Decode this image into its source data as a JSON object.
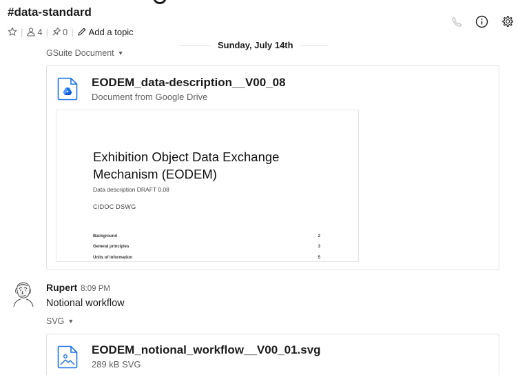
{
  "channel": {
    "name": "#data-standard",
    "members_count": "4",
    "pins_count": "0",
    "add_topic_label": "Add a topic"
  },
  "header_icons": [
    "phone-icon",
    "info-icon",
    "gear-icon"
  ],
  "date_divider": "Sunday, July 14th",
  "attachment1": {
    "type_label": "GSuite Document",
    "title": "EODEM_data-description__V00_08",
    "subtitle": "Document from Google Drive",
    "preview": {
      "title": "Exhibition Object Data Exchange Mechanism (EODEM)",
      "subtitle": "Data description DRAFT 0.08",
      "org": "CIDOC DSWG",
      "toc": [
        {
          "label": "Background",
          "page": "2"
        },
        {
          "label": "General principles",
          "page": "3"
        },
        {
          "label": "Units of information",
          "page": "5"
        }
      ]
    }
  },
  "message": {
    "author": "Rupert",
    "time": "8:09 PM",
    "text": "Notional workflow"
  },
  "attachment2": {
    "type_label": "SVG",
    "title": "EODEM_notional_workflow__V00_01.svg",
    "subtitle": "289 kB SVG"
  },
  "colors": {
    "text": "#1d1c1d",
    "muted": "#616061",
    "border": "#e1e1e1",
    "drive_blue": "#1a73e8"
  }
}
